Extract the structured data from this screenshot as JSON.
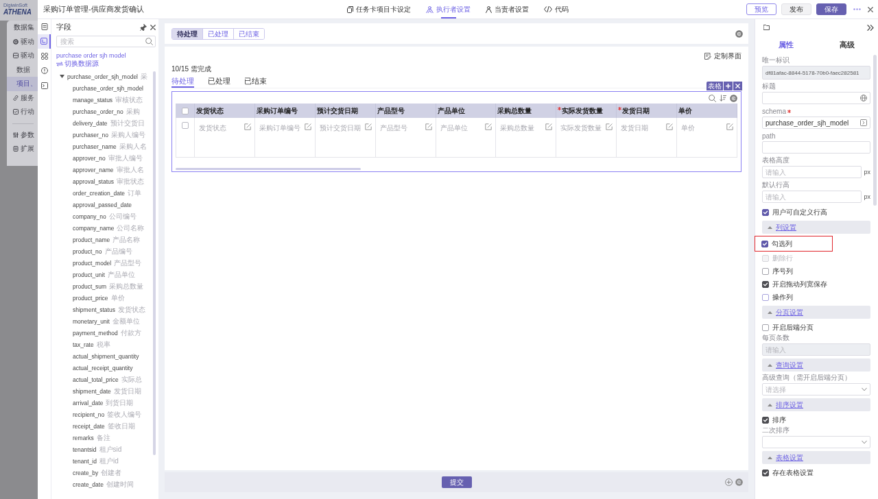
{
  "backdrop": {
    "logo_caption": "DigiwinSoft",
    "logo": "ATHENA",
    "menu": [
      {
        "kind": "group",
        "label": "数据集",
        "selected": false
      },
      {
        "kind": "item",
        "label": "驱动",
        "selected": false
      },
      {
        "kind": "item",
        "label": "驱动",
        "selected": false
      },
      {
        "kind": "sub",
        "label": "数据",
        "selected": false
      },
      {
        "kind": "sub",
        "label": "项目、",
        "selected": true
      },
      {
        "kind": "item",
        "label": "服务",
        "selected": false
      },
      {
        "kind": "item",
        "label": "行动",
        "selected": false
      },
      {
        "kind": "divider"
      },
      {
        "kind": "item",
        "label": "参数",
        "selected": false
      },
      {
        "kind": "item",
        "label": "扩展",
        "selected": false
      }
    ]
  },
  "dialog": {
    "title": "采购订单管理-供应商发货确认",
    "tabs": [
      {
        "label": "任务卡项目卡设定",
        "selected": false
      },
      {
        "label": "执行者设置",
        "selected": true
      },
      {
        "label": "当责者设置",
        "selected": false
      },
      {
        "label": "代码",
        "selected": false
      }
    ],
    "actions": [
      {
        "label": "预览",
        "kind": "outline"
      },
      {
        "label": "发布",
        "kind": "plain"
      },
      {
        "label": "保存",
        "kind": "primary"
      }
    ]
  },
  "rail": [
    {
      "selected": false
    },
    {
      "selected": true
    },
    {
      "selected": false
    },
    {
      "selected": false
    },
    {
      "selected": false
    }
  ],
  "field_panel": {
    "title": "字段",
    "search": {
      "placeholder": "搜索"
    },
    "datasource": "purchase order sjh model",
    "switch_link": "切换数据源",
    "tree": {
      "name": "purchase_order_sjh_model",
      "caption": "采",
      "expanded": true,
      "children": [
        {
          "name": "purchase_order_sjh_model"
        },
        {
          "name": "manage_status",
          "caption": "审核状态"
        },
        {
          "name": "purchase_order_no",
          "caption": "采购"
        },
        {
          "name": "delivery_date",
          "caption": "预计交货日"
        },
        {
          "name": "purchaser_no",
          "caption": "采购人编号"
        },
        {
          "name": "purchaser_name",
          "caption": "采购人名"
        },
        {
          "name": "approver_no",
          "caption": "审批人编号"
        },
        {
          "name": "approver_name",
          "caption": "审批人名"
        },
        {
          "name": "approval_status",
          "caption": "审批状态"
        },
        {
          "name": "order_creation_date",
          "caption": "订单"
        },
        {
          "name": "approval_passed_date"
        },
        {
          "name": "company_no",
          "caption": "公司编号"
        },
        {
          "name": "company_name",
          "caption": "公司名称"
        },
        {
          "name": "product_name",
          "caption": "产品名称"
        },
        {
          "name": "product_no",
          "caption": "产品编号"
        },
        {
          "name": "product_model",
          "caption": "产品型号"
        },
        {
          "name": "product_unit",
          "caption": "产品单位"
        },
        {
          "name": "product_sum",
          "caption": "采购总数量"
        },
        {
          "name": "product_price",
          "caption": "单价"
        },
        {
          "name": "shipment_status",
          "caption": "发货状态"
        },
        {
          "name": "monetary_unit",
          "caption": "金额单位"
        },
        {
          "name": "payment_method",
          "caption": "付款方"
        },
        {
          "name": "tax_rate",
          "caption": "税率"
        },
        {
          "name": "actual_shipment_quantity"
        },
        {
          "name": "actual_receipt_quantity"
        },
        {
          "name": "actual_total_price",
          "caption": "实际总"
        },
        {
          "name": "shipment_date",
          "caption": "发货日期"
        },
        {
          "name": "arrival_date",
          "caption": "到货日期"
        },
        {
          "name": "recipient_no",
          "caption": "签收人编号"
        },
        {
          "name": "receipt_date",
          "caption": "签收日期"
        },
        {
          "name": "remarks",
          "caption": "备注"
        },
        {
          "name": "tenantsid",
          "caption": "租户sid"
        },
        {
          "name": "tenant_id",
          "caption": "租户id"
        },
        {
          "name": "create_by",
          "caption": "创建者"
        },
        {
          "name": "create_date",
          "caption": "创建时间"
        }
      ]
    }
  },
  "canvas": {
    "status_tabs": [
      {
        "label": "待处理",
        "selected": true
      },
      {
        "label": "已处理",
        "selected": false
      },
      {
        "label": "已结束",
        "selected": false
      }
    ],
    "customize_button": "定制界面",
    "progress": "10/15 需完成",
    "tabs": [
      {
        "label": "待处理",
        "selected": true
      },
      {
        "label": "已处理",
        "selected": false
      },
      {
        "label": "已结束",
        "selected": false
      }
    ],
    "table_badge": "表格",
    "table": {
      "select_all": {
        "checked": false
      },
      "columns": [
        {
          "label": "发货状态",
          "required": false
        },
        {
          "label": "采购订单编号",
          "required": false
        },
        {
          "label": "预计交货日期",
          "required": false
        },
        {
          "label": "产品型号",
          "required": false
        },
        {
          "label": "产品单位",
          "required": false
        },
        {
          "label": "采购总数量",
          "required": false
        },
        {
          "label": "实际发货数量",
          "required": true
        },
        {
          "label": "发货日期",
          "required": true
        },
        {
          "label": "单价",
          "required": false
        }
      ],
      "rows": [
        {
          "checked": false,
          "cells": [
            "发货状态",
            "采购订单编号",
            "预计交货日期",
            "产品型号",
            "产品单位",
            "采购总数量",
            "实际发货数量",
            "发货日期",
            "单价"
          ]
        }
      ]
    },
    "submit_button": "提交"
  },
  "properties": {
    "tabs": [
      {
        "label": "属性",
        "selected": true
      },
      {
        "label": "高级",
        "selected": false
      }
    ],
    "items": [
      {
        "kind": "input",
        "label": "唯一标识",
        "value": "df81afac-8844-5178-70b0-faec282581",
        "disabled": true
      },
      {
        "kind": "i18n-input",
        "label": "标题",
        "disabled": false
      },
      {
        "kind": "picker",
        "label": "schema",
        "required": true,
        "value": "purchase_order_sjh_model",
        "disabled": false
      },
      {
        "kind": "input",
        "label": "path",
        "disabled": false
      },
      {
        "kind": "input",
        "label": "表格高度",
        "placeholder": "请输入",
        "suffix": "px",
        "disabled": false
      },
      {
        "kind": "input",
        "label": "默认行高",
        "placeholder": "请输入",
        "suffix": "px",
        "disabled": false
      },
      {
        "kind": "checkbox",
        "label": "用户可自定义行高",
        "checked": true,
        "disabled": false,
        "highlighted": false,
        "color": "#5f59aa"
      },
      {
        "kind": "section",
        "label": "列设置",
        "expanded": true
      },
      {
        "kind": "checkbox",
        "label": "勾选列",
        "checked": true,
        "disabled": false,
        "highlighted": true,
        "color": "#5f59aa"
      },
      {
        "kind": "checkbox",
        "label": "删除行",
        "checked": false,
        "disabled": true,
        "highlighted": false,
        "color": "#d6d6db"
      },
      {
        "kind": "checkbox",
        "label": "序号列",
        "checked": false,
        "disabled": false,
        "highlighted": false,
        "color": "#a3a3ab"
      },
      {
        "kind": "checkbox",
        "label": "开启拖动列宽保存",
        "checked": true,
        "disabled": false,
        "highlighted": false,
        "color": "#4d4d52"
      },
      {
        "kind": "checkbox",
        "label": "操作列",
        "checked": false,
        "disabled": false,
        "highlighted": false,
        "color": "#a9a5dd"
      },
      {
        "kind": "section",
        "label": "分页设置",
        "expanded": true
      },
      {
        "kind": "checkbox",
        "label": "开启后端分页",
        "checked": false,
        "disabled": false,
        "highlighted": false,
        "color": "#a3a3ab"
      },
      {
        "kind": "input",
        "label": "每页条数",
        "placeholder": "请输入",
        "disabled": true
      },
      {
        "kind": "section",
        "label": "查询设置",
        "expanded": true
      },
      {
        "kind": "select",
        "label": "高级查询（需开启后端分页）",
        "placeholder": "请选择",
        "disabled": false
      },
      {
        "kind": "section",
        "label": "排序设置",
        "expanded": true
      },
      {
        "kind": "checkbox",
        "label": "排序",
        "checked": true,
        "disabled": false,
        "highlighted": false,
        "color": "#4d4d52"
      },
      {
        "kind": "select",
        "label": "二次排序",
        "disabled": false
      },
      {
        "kind": "section",
        "label": "表格设置",
        "expanded": true
      },
      {
        "kind": "checkbox",
        "label": "存在表格设置",
        "checked": true,
        "disabled": false,
        "highlighted": false,
        "color": "#4d4d52"
      }
    ]
  }
}
